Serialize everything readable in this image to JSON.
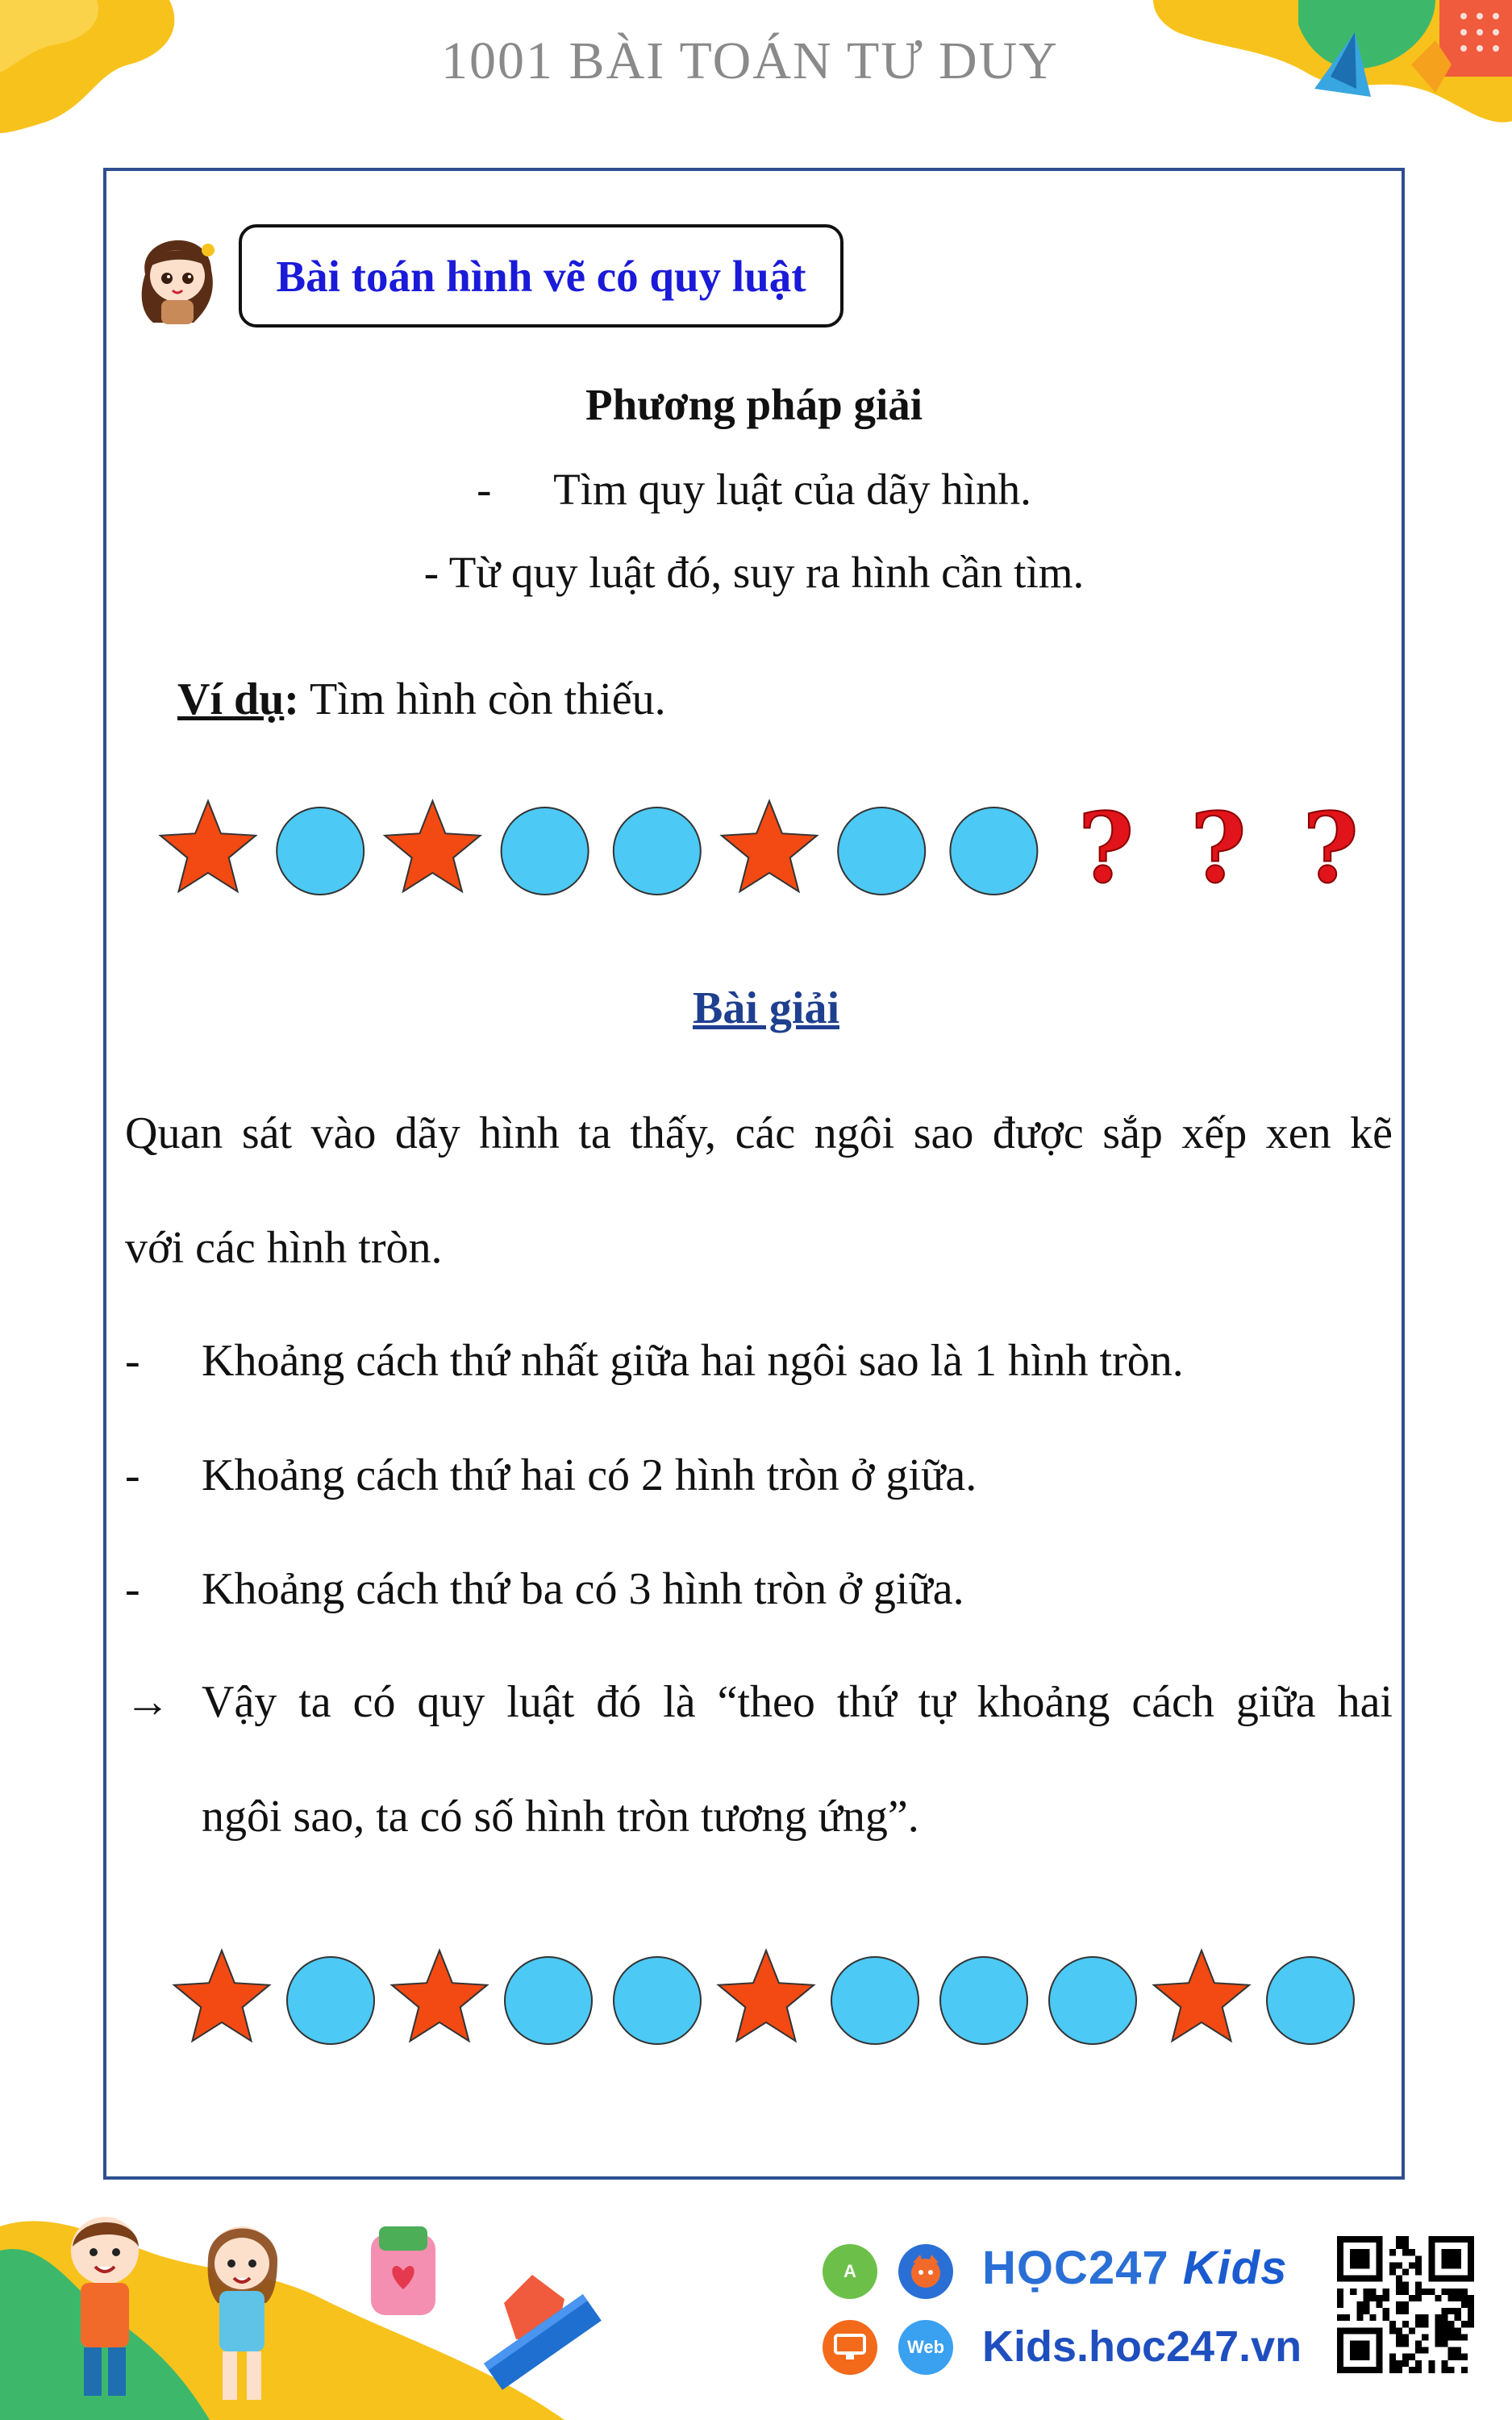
{
  "header": {
    "title": "1001 BÀI TOÁN TƯ DUY"
  },
  "topic": {
    "title": "Bài toán hình vẽ có quy luật"
  },
  "method": {
    "heading": "Phương pháp giải",
    "step1_dash": "-",
    "step1": "Tìm quy luật của dãy hình.",
    "step2": "- Từ quy luật đó, suy ra hình cần tìm."
  },
  "example": {
    "label": "Ví dụ",
    "colon": ":",
    "text": " Tìm hình còn thiếu."
  },
  "question_sequence": [
    "star",
    "circle",
    "star",
    "circle",
    "circle",
    "star",
    "circle",
    "circle",
    "?",
    "?",
    "?"
  ],
  "solution": {
    "heading": "Bài giải",
    "para_line1": "Quan sát vào dãy hình ta thấy, các ngôi sao được sắp xếp xen kẽ",
    "para_line2": "với các hình tròn.",
    "bullet_mark": "-",
    "bullets": [
      "Khoảng cách thứ nhất giữa hai ngôi sao là 1 hình tròn.",
      "Khoảng cách thứ hai có 2 hình tròn ở giữa.",
      "Khoảng cách thứ ba có 3 hình tròn ở giữa."
    ],
    "arrow": "→",
    "conclusion_line1": "Vậy ta có quy luật đó là “theo thứ tự khoảng cách giữa hai",
    "conclusion_line2": "ngôi sao, ta có số hình tròn tương ứng”."
  },
  "answer_sequence": [
    "star",
    "circle",
    "star",
    "circle",
    "circle",
    "star",
    "circle",
    "circle",
    "circle",
    "star",
    "circle"
  ],
  "footer": {
    "brand_main": "HỌC247",
    "brand_kids": "Kids",
    "site": "Kids.hoc247.vn",
    "web_label": "Web"
  },
  "colors": {
    "star": "#f24a12",
    "circle": "#4cc9f5",
    "question": "#e0141a",
    "frame": "#2e4f8f",
    "topic_text": "#1a1ad8",
    "solution_heading": "#1f3f8f"
  }
}
